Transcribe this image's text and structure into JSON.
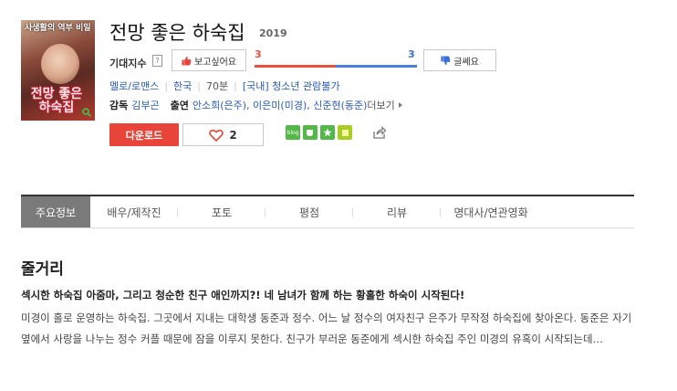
{
  "movie": {
    "title": "전망 좋은 하숙집",
    "year": "2019",
    "poster": {
      "top_text": "사생활의 역부 비밀",
      "title_text": "전망 좋은 하숙집"
    }
  },
  "expectation": {
    "label": "기대지수",
    "help": "?",
    "want_label": "보고싶어요",
    "meh_label": "글쎄요",
    "want_count": "3",
    "meh_count": "3",
    "want_ratio": 0.5
  },
  "meta": {
    "genre": "멜로/로맨스",
    "country": "한국",
    "runtime": "70분",
    "rating": "[국내] 청소년 관람불가"
  },
  "credits": {
    "director_label": "감독",
    "director": "김부곤",
    "cast_label": "출연",
    "cast": "안소희(은주), 이은미(미경), 신준현(동준)",
    "more": "더보기"
  },
  "actions": {
    "download_label": "다운로드",
    "like_count": "2",
    "blog_label": "blog"
  },
  "tabs": [
    {
      "label": "주요정보"
    },
    {
      "label": "배우/제작진"
    },
    {
      "label": "포토"
    },
    {
      "label": "평점"
    },
    {
      "label": "리뷰"
    },
    {
      "label": "명대사/연관영화"
    }
  ],
  "synopsis": {
    "heading": "줄거리",
    "lead": "섹시한 하숙집 아줌마, 그리고 청순한 친구 애인까지?! 네 남녀가 함께 하는 황홀한 하숙이 시작된다!",
    "body": "미경이 홀로 운영하는 하숙집. 그곳에서 지내는 대학생 동준과 정수. 어느 날 정수의 여자친구 은주가 무작정 하숙집에 찾아온다. 동준은 자기 옆에서 사랑을 나누는 정수 커플 때문에 잠을 이루지 못한다. 친구가 부러운 동준에게 섹시한 하숙집 주인 미경의 유혹이 시작되는데…"
  },
  "colors": {
    "accent_red": "#e8443a",
    "accent_blue": "#3a6fd8",
    "tab_active": "#7a7a7a"
  }
}
